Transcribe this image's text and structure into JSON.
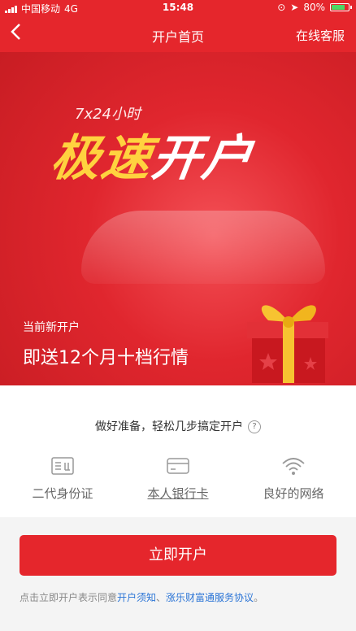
{
  "status": {
    "carrier": "中国移动",
    "network": "4G",
    "time": "15:48",
    "battery": "80%",
    "battery_level": 0.8
  },
  "nav": {
    "back_label": "‹",
    "title": "开户首页",
    "service": "在线客服"
  },
  "banner": {
    "hours": "7x24小时",
    "headline_part1": "极速",
    "headline_part2": "开户",
    "current": "当前新开户",
    "offer": "即送12个月十档行情"
  },
  "prepare": {
    "text": "做好准备，轻松几步搞定开户",
    "help_icon": "?"
  },
  "requirements": [
    {
      "label": "二代身份证",
      "icon": "id-card-icon"
    },
    {
      "label": "本人银行卡",
      "icon": "bank-card-icon"
    },
    {
      "label": "良好的网络",
      "icon": "wifi-icon"
    }
  ],
  "button": {
    "label": "立即开户"
  },
  "agreement": {
    "prefix": "点击立即开户表示同意",
    "link1": "开户须知",
    "sep": "、",
    "link2": "涨乐财富通服务协议",
    "suffix": "。"
  },
  "colors": {
    "brand": "#e5262c",
    "link": "#2a74d6",
    "gold": "#ffd23f"
  }
}
